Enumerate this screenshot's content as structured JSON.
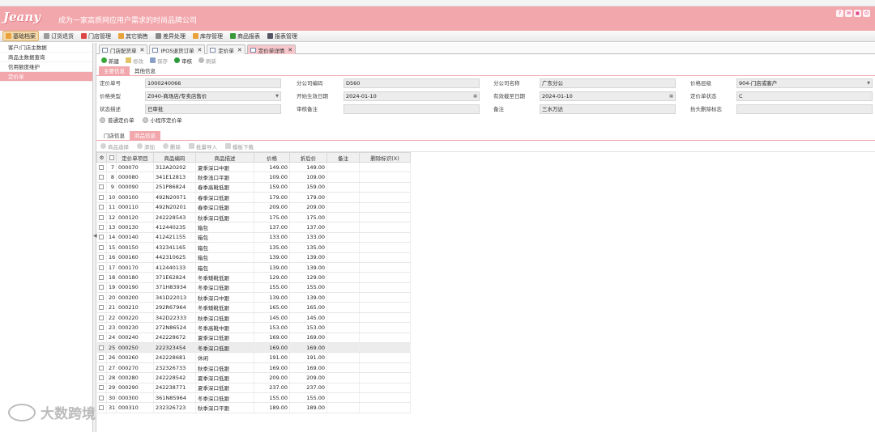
{
  "app": {
    "logo": "Jeany",
    "slogan": "成为一家高质网应用户需求的时尚品牌公司"
  },
  "main_menu": [
    {
      "label": "基础档案",
      "icon": "folder-icon",
      "color": "#e9a23b",
      "active": true
    },
    {
      "label": "订货退货",
      "icon": "order-icon",
      "color": "#9a9a9a"
    },
    {
      "label": "门店管理",
      "icon": "store-icon",
      "color": "#d44"
    },
    {
      "label": "其它销售",
      "icon": "sales-icon",
      "color": "#e9a23b"
    },
    {
      "label": "差异处理",
      "icon": "gear-icon",
      "color": "#888"
    },
    {
      "label": "库存管理",
      "icon": "inventory-icon",
      "color": "#e9a23b"
    },
    {
      "label": "商品报表",
      "icon": "leaf-icon",
      "color": "#3a9a3a"
    },
    {
      "label": "报表管理",
      "icon": "report-icon",
      "color": "#556"
    }
  ],
  "sidebar": {
    "items": [
      {
        "label": "客户/门店主数据"
      },
      {
        "label": "商品主数据查询"
      },
      {
        "label": "信用额度维护"
      },
      {
        "label": "定价单",
        "active": true
      }
    ]
  },
  "tabs": [
    {
      "label": "门店配货单"
    },
    {
      "label": "IPOS退货订单"
    },
    {
      "label": "定价单"
    },
    {
      "label": "定价单详情",
      "active": true
    }
  ],
  "toolbar": {
    "new": "新建",
    "edit": "修改",
    "save": "保存",
    "approve": "审核",
    "refresh": "刷新"
  },
  "detail_tabs": {
    "main": "主要信息",
    "other": "其他信息"
  },
  "form": {
    "price_no_label": "定价单号",
    "price_no": "1000240066",
    "branch_code_label": "分公司编码",
    "branch_code": "D560",
    "branch_name_label": "分公司名称",
    "branch_name": "广东分公",
    "price_level_label": "价格层级",
    "price_level": "904-门店或客户",
    "price_type_label": "价格类型",
    "price_type": "Z040-商场店/专卖店售价",
    "start_date_label": "开始生效日期",
    "start_date": "2024-01-10",
    "end_date_label": "有效截至日期",
    "end_date": "2024-01-10",
    "status_label": "定价单状态",
    "status": "C",
    "status_desc_label": "状态描述",
    "status_desc": "已审批",
    "audit_note_label": "审核备注",
    "audit_note": "",
    "remark_label": "备注",
    "remark": "三水万达",
    "header_del_label": "抬头删除标志",
    "header_del": "",
    "radio_normal": "普通定价单",
    "radio_mini": "小程序定价单"
  },
  "list_tabs": {
    "store": "门店信息",
    "goods": "商品信息"
  },
  "list_toolbar": {
    "select": "商品选择",
    "add": "添加",
    "delete": "删除",
    "import": "批量导入",
    "template": "模板下载"
  },
  "grid": {
    "columns": [
      "定价单项目",
      "商品编码",
      "商品描述",
      "价格",
      "折后价",
      "备注",
      "删除标识(X)"
    ],
    "rows": [
      {
        "n": "7",
        "item": "000070",
        "code": "312A20202",
        "desc": "夏季深口中跟",
        "price": "149.00",
        "disc": "149.00"
      },
      {
        "n": "8",
        "item": "000080",
        "code": "341E12813",
        "desc": "秋季浅口平跟",
        "price": "109.00",
        "disc": "109.00"
      },
      {
        "n": "9",
        "item": "000090",
        "code": "251P86824",
        "desc": "春季高靴低跟",
        "price": "159.00",
        "disc": "159.00"
      },
      {
        "n": "10",
        "item": "000100",
        "code": "492N20071",
        "desc": "春季深口低跟",
        "price": "179.00",
        "disc": "179.00"
      },
      {
        "n": "11",
        "item": "000110",
        "code": "492N20201",
        "desc": "春季深口低跟",
        "price": "209.00",
        "disc": "209.00"
      },
      {
        "n": "12",
        "item": "000120",
        "code": "242228543",
        "desc": "秋季深口低跟",
        "price": "175.00",
        "disc": "175.00"
      },
      {
        "n": "13",
        "item": "000130",
        "code": "412440235",
        "desc": "箱包",
        "price": "137.00",
        "disc": "137.00"
      },
      {
        "n": "14",
        "item": "000140",
        "code": "412421155",
        "desc": "箱包",
        "price": "133.00",
        "disc": "133.00"
      },
      {
        "n": "15",
        "item": "000150",
        "code": "432341165",
        "desc": "箱包",
        "price": "135.00",
        "disc": "135.00"
      },
      {
        "n": "16",
        "item": "000160",
        "code": "442310625",
        "desc": "箱包",
        "price": "139.00",
        "disc": "139.00"
      },
      {
        "n": "17",
        "item": "000170",
        "code": "412440133",
        "desc": "箱包",
        "price": "139.00",
        "disc": "139.00"
      },
      {
        "n": "18",
        "item": "000180",
        "code": "371E62824",
        "desc": "冬季矮靴低跟",
        "price": "129.00",
        "disc": "129.00"
      },
      {
        "n": "19",
        "item": "000190",
        "code": "371H83934",
        "desc": "冬季深口低跟",
        "price": "155.00",
        "disc": "155.00"
      },
      {
        "n": "20",
        "item": "000200",
        "code": "341D22013",
        "desc": "秋季深口中跟",
        "price": "139.00",
        "disc": "139.00"
      },
      {
        "n": "21",
        "item": "000210",
        "code": "292R67964",
        "desc": "冬季矮靴低跟",
        "price": "165.00",
        "disc": "165.00"
      },
      {
        "n": "22",
        "item": "000220",
        "code": "342D22333",
        "desc": "秋季深口低跟",
        "price": "145.00",
        "disc": "145.00"
      },
      {
        "n": "23",
        "item": "000230",
        "code": "272N86524",
        "desc": "冬季高靴中跟",
        "price": "153.00",
        "disc": "153.00"
      },
      {
        "n": "24",
        "item": "000240",
        "code": "242228672",
        "desc": "夏季深口低跟",
        "price": "169.00",
        "disc": "169.00"
      },
      {
        "n": "25",
        "item": "000250",
        "code": "222323454",
        "desc": "冬季深口低跟",
        "price": "169.00",
        "disc": "169.00",
        "sel": true
      },
      {
        "n": "26",
        "item": "000260",
        "code": "242228681",
        "desc": "休闲",
        "price": "191.00",
        "disc": "191.00"
      },
      {
        "n": "27",
        "item": "000270",
        "code": "232326733",
        "desc": "秋季深口低跟",
        "price": "169.00",
        "disc": "169.00"
      },
      {
        "n": "28",
        "item": "000280",
        "code": "242228542",
        "desc": "夏季深口低跟",
        "price": "209.00",
        "disc": "209.00"
      },
      {
        "n": "29",
        "item": "000290",
        "code": "242238771",
        "desc": "夏季深口低跟",
        "price": "237.00",
        "disc": "237.00"
      },
      {
        "n": "30",
        "item": "000300",
        "code": "361N85964",
        "desc": "冬季深口低跟",
        "price": "155.00",
        "disc": "155.00"
      },
      {
        "n": "31",
        "item": "000310",
        "code": "232326723",
        "desc": "秋季深口平跟",
        "price": "189.00",
        "disc": "189.00"
      }
    ]
  },
  "watermark": "大数跨境"
}
